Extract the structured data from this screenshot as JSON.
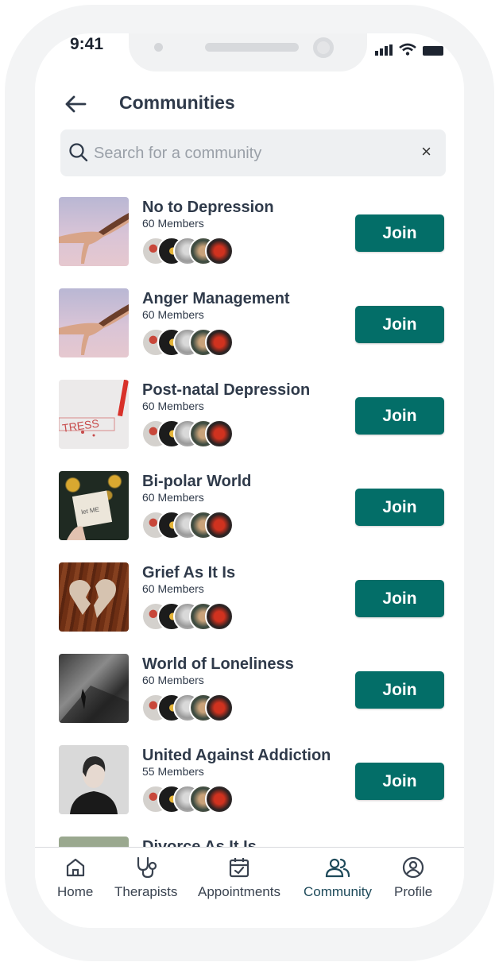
{
  "status_bar": {
    "time": "9:41"
  },
  "header": {
    "title": "Communities"
  },
  "search": {
    "placeholder": "Search for a community",
    "value": ""
  },
  "communities": [
    {
      "name": "No to Depression",
      "members": "60 Members",
      "join": "Join"
    },
    {
      "name": "Anger Management",
      "members": "60 Members",
      "join": "Join"
    },
    {
      "name": "Post-natal Depression",
      "members": "60 Members",
      "join": "Join"
    },
    {
      "name": "Bi-polar World",
      "members": "60 Members",
      "join": "Join"
    },
    {
      "name": "Grief As It Is",
      "members": "60 Members",
      "join": "Join"
    },
    {
      "name": "World of Loneliness",
      "members": "60 Members",
      "join": "Join"
    },
    {
      "name": "United Against Addiction",
      "members": "55 Members",
      "join": "Join"
    },
    {
      "name": "Divorce As It Is"
    }
  ],
  "nav": {
    "items": [
      {
        "label": "Home",
        "icon": "home-icon"
      },
      {
        "label": "Therapists",
        "icon": "stethoscope-icon"
      },
      {
        "label": "Appointments",
        "icon": "calendar-check-icon"
      },
      {
        "label": "Community",
        "icon": "users-icon",
        "active": true
      },
      {
        "label": "Profile",
        "icon": "user-circle-icon"
      }
    ]
  },
  "colors": {
    "accent": "#036e68",
    "search_bg": "#eef0f2",
    "text": "#2f3a4a"
  }
}
